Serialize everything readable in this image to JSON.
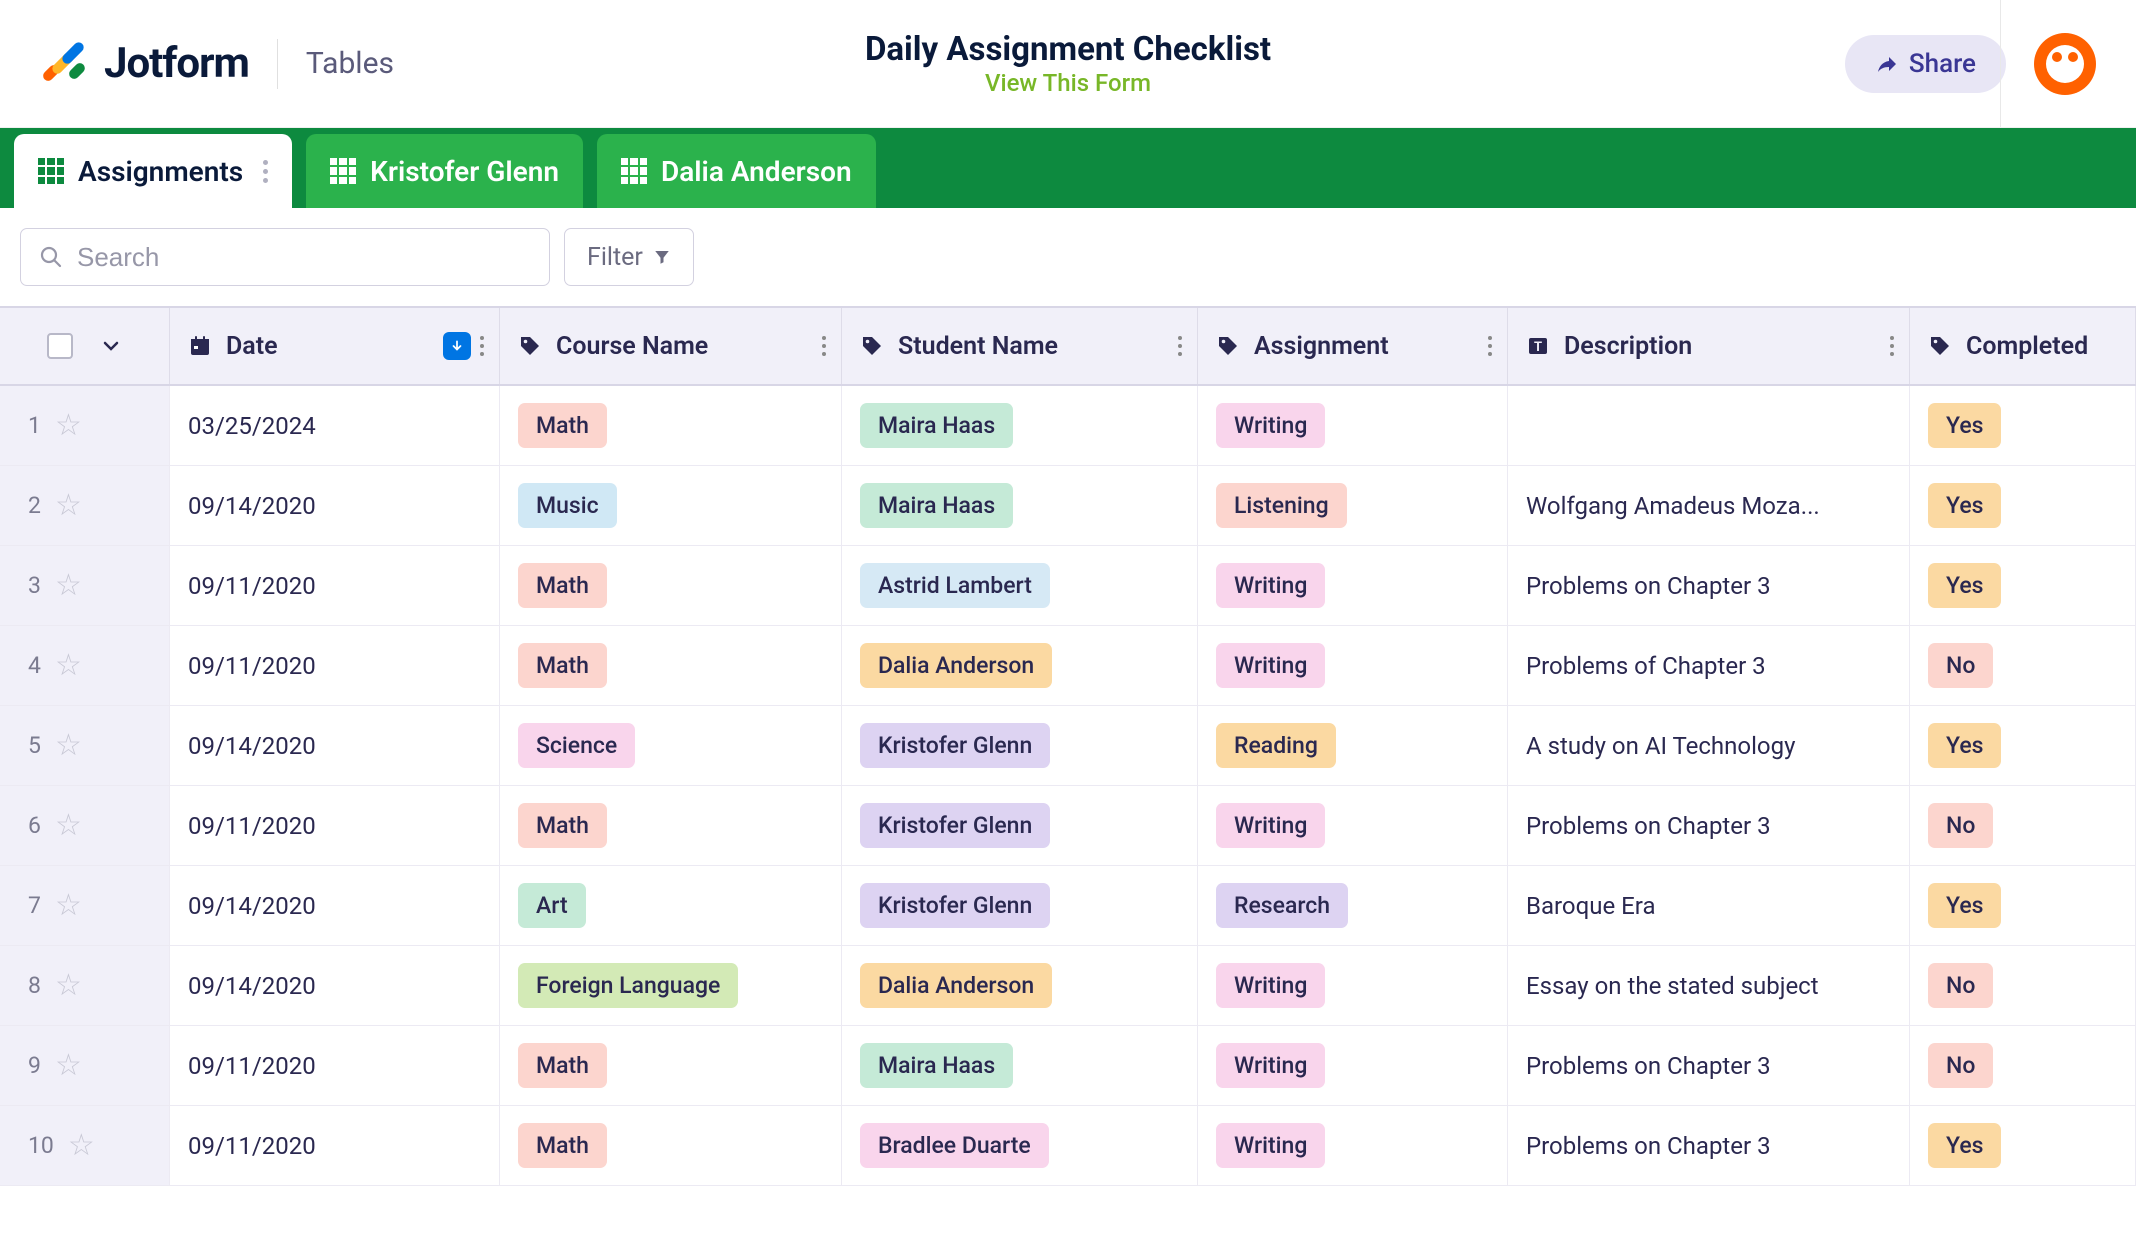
{
  "header": {
    "brand": "Jotform",
    "product": "Tables",
    "title": "Daily Assignment Checklist",
    "view_link": "View This Form",
    "share_label": "Share"
  },
  "tabs": [
    {
      "label": "Assignments",
      "active": true
    },
    {
      "label": "Kristofer Glenn",
      "active": false
    },
    {
      "label": "Dalia Anderson",
      "active": false
    }
  ],
  "toolbar": {
    "search_placeholder": "Search",
    "filter_label": "Filter"
  },
  "columns": {
    "date": "Date",
    "course": "Course Name",
    "student": "Student Name",
    "assignment": "Assignment",
    "description": "Description",
    "completed": "Completed"
  },
  "pill_colors": {
    "course": {
      "Math": "c-red",
      "Music": "c-blue",
      "Science": "c-pink",
      "Art": "c-mint",
      "Foreign Language": "c-green"
    },
    "student": {
      "Maira Haas": "c-mint",
      "Astrid Lambert": "c-ltblue",
      "Dalia Anderson": "c-orange",
      "Kristofer Glenn": "c-purple",
      "Bradlee Duarte": "c-pink"
    },
    "assignment": {
      "Writing": "c-pink",
      "Listening": "c-red",
      "Reading": "c-orange",
      "Research": "c-purple"
    },
    "completed": {
      "Yes": "c-yes",
      "No": "c-no"
    }
  },
  "rows": [
    {
      "n": 1,
      "date": "03/25/2024",
      "course": "Math",
      "student": "Maira Haas",
      "assignment": "Writing",
      "description": "",
      "completed": "Yes"
    },
    {
      "n": 2,
      "date": "09/14/2020",
      "course": "Music",
      "student": "Maira Haas",
      "assignment": "Listening",
      "description": "Wolfgang Amadeus Moza...",
      "completed": "Yes"
    },
    {
      "n": 3,
      "date": "09/11/2020",
      "course": "Math",
      "student": "Astrid Lambert",
      "assignment": "Writing",
      "description": "Problems on Chapter 3",
      "completed": "Yes"
    },
    {
      "n": 4,
      "date": "09/11/2020",
      "course": "Math",
      "student": "Dalia Anderson",
      "assignment": "Writing",
      "description": "Problems of Chapter 3",
      "completed": "No"
    },
    {
      "n": 5,
      "date": "09/14/2020",
      "course": "Science",
      "student": "Kristofer Glenn",
      "assignment": "Reading",
      "description": "A study on AI Technology",
      "completed": "Yes"
    },
    {
      "n": 6,
      "date": "09/11/2020",
      "course": "Math",
      "student": "Kristofer Glenn",
      "assignment": "Writing",
      "description": "Problems on Chapter 3",
      "completed": "No"
    },
    {
      "n": 7,
      "date": "09/14/2020",
      "course": "Art",
      "student": "Kristofer Glenn",
      "assignment": "Research",
      "description": "Baroque Era",
      "completed": "Yes"
    },
    {
      "n": 8,
      "date": "09/14/2020",
      "course": "Foreign Language",
      "student": "Dalia Anderson",
      "assignment": "Writing",
      "description": "Essay on the stated subject",
      "completed": "No"
    },
    {
      "n": 9,
      "date": "09/11/2020",
      "course": "Math",
      "student": "Maira Haas",
      "assignment": "Writing",
      "description": "Problems on Chapter 3",
      "completed": "No"
    },
    {
      "n": 10,
      "date": "09/11/2020",
      "course": "Math",
      "student": "Bradlee Duarte",
      "assignment": "Writing",
      "description": "Problems on Chapter 3",
      "completed": "Yes"
    }
  ]
}
